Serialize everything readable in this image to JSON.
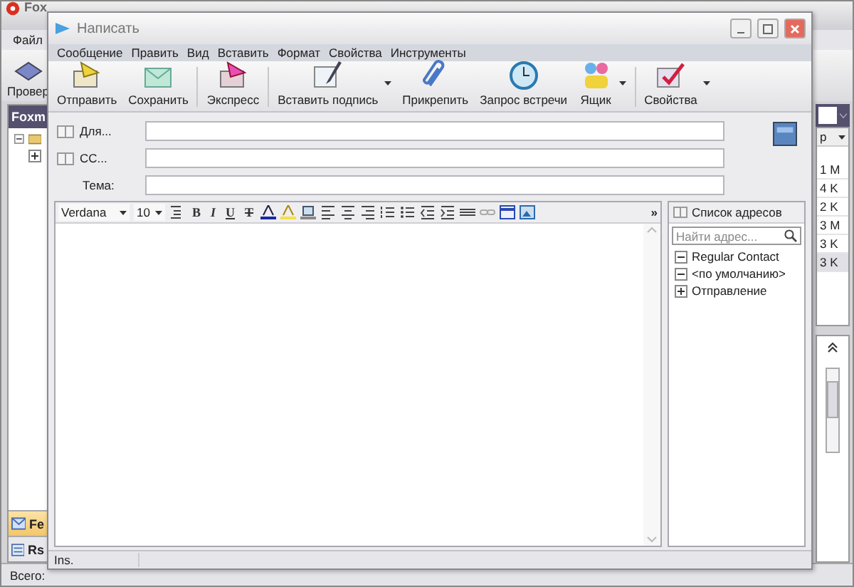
{
  "background_window": {
    "title": "Fox",
    "menu": [
      "Файл"
    ],
    "toolbar": [
      {
        "label": "Провер"
      }
    ],
    "folders_header": "Foxm",
    "folder_tree": [
      {
        "expanded": true,
        "children": [
          {
            "expanded": false
          }
        ]
      }
    ],
    "nav_tabs": [
      {
        "label": "Fe",
        "selected": true
      },
      {
        "label": "Rs",
        "selected": false
      }
    ],
    "list_header": "р",
    "list_rows": [
      {
        "size": "1 M",
        "selected": false
      },
      {
        "size": "4 K",
        "selected": false
      },
      {
        "size": "2 K",
        "selected": false
      },
      {
        "size": "3 M",
        "selected": false
      },
      {
        "size": "3 K",
        "selected": false
      },
      {
        "size": "3 K",
        "selected": true
      }
    ],
    "status_bar": "Всего: "
  },
  "compose_window": {
    "title": "Написать",
    "menu": [
      "Сообщение",
      "Править",
      "Вид",
      "Вставить",
      "Формат",
      "Свойства",
      "Инструменты"
    ],
    "toolbar": [
      {
        "label": "Отправить",
        "kind": "send",
        "dropdown": false
      },
      {
        "label": "Сохранить",
        "kind": "save",
        "dropdown": false
      },
      {
        "label": "Экспресс",
        "kind": "express",
        "dropdown": false
      },
      {
        "label": "Вставить подпись",
        "kind": "signature",
        "dropdown": true
      },
      {
        "label": "Прикрепить",
        "kind": "attach",
        "dropdown": false
      },
      {
        "label": "Запрос встречи",
        "kind": "meeting",
        "dropdown": false
      },
      {
        "label": "Ящик",
        "kind": "mailbox",
        "dropdown": true
      },
      {
        "label": "Свойства",
        "kind": "properties",
        "dropdown": true
      }
    ],
    "fields": [
      {
        "label": "Для...",
        "kind": "contact"
      },
      {
        "label": "CC...",
        "kind": "contact"
      },
      {
        "label": "Тема:",
        "kind": "plain"
      }
    ],
    "editor_toolbar": {
      "font": "Verdana",
      "size": "10",
      "more": "»",
      "format_buttons": [
        {
          "label": "B",
          "kind": "bold"
        },
        {
          "label": "I",
          "kind": "italic"
        },
        {
          "label": "U",
          "kind": "underline"
        },
        {
          "label": "T",
          "kind": "strike"
        }
      ]
    },
    "address_book": {
      "title": "Список адресов",
      "search": {
        "placeholder": "Найти адрес..."
      },
      "groups": [
        {
          "name": "Regular Contact",
          "expanded": true
        },
        {
          "name": "<по умолчанию>",
          "expanded": true
        },
        {
          "name": "Отправление",
          "expanded": false
        }
      ]
    },
    "status_bar": "Ins."
  }
}
